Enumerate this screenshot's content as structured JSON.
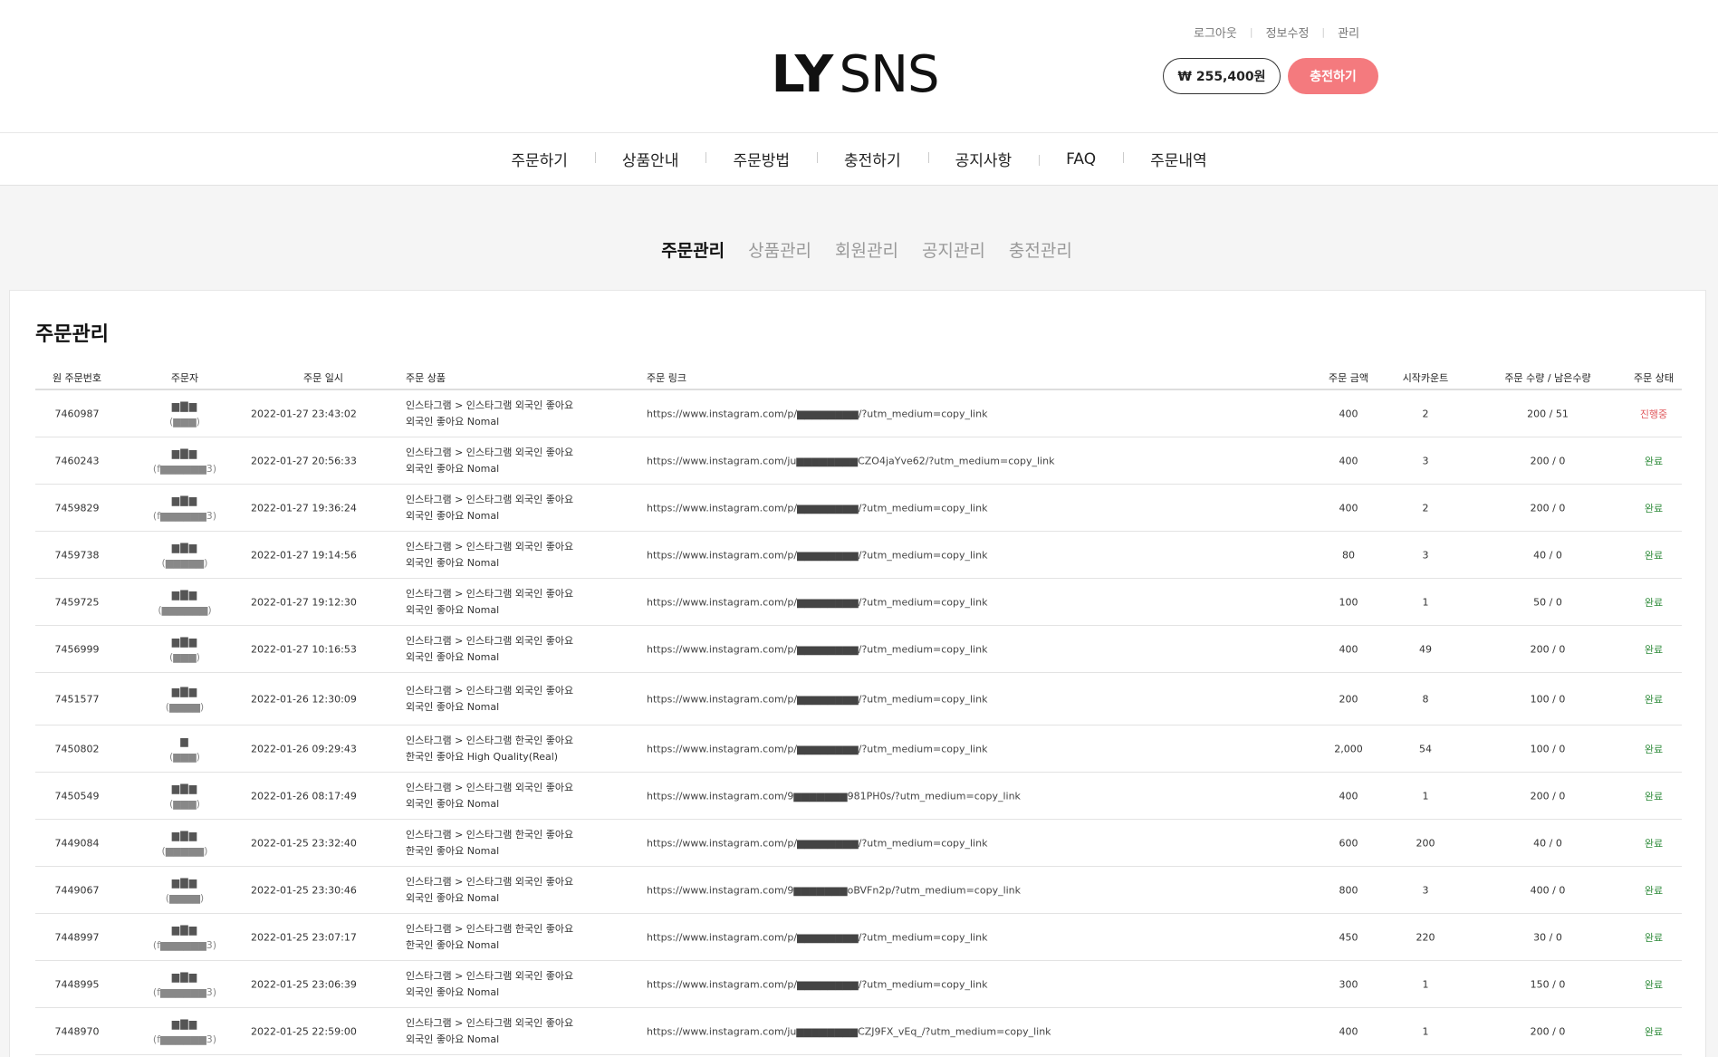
{
  "util_links": [
    "로그아웃",
    "정보수정",
    "관리"
  ],
  "logo": {
    "ly": "LY",
    "sns": "SNS"
  },
  "balance": "₩ 255,400원",
  "charge_button": "충전하기",
  "gnb": [
    "주문하기",
    "상품안내",
    "주문방법",
    "충전하기",
    "공지사항",
    "FAQ",
    "주문내역"
  ],
  "admin_tabs": [
    {
      "label": "주문관리",
      "active": true
    },
    {
      "label": "상품관리",
      "active": false
    },
    {
      "label": "회원관리",
      "active": false
    },
    {
      "label": "공지관리",
      "active": false
    },
    {
      "label": "충전관리",
      "active": false
    }
  ],
  "panel_title": "주문관리",
  "columns": {
    "order_no": "원 주문번호",
    "user": "주문자",
    "date": "주문 일시",
    "product": "주문 상품",
    "link": "주문 링크",
    "amount": "주문 금액",
    "start": "시작카운트",
    "qty": "주문 수량 / 남은수량",
    "status": "주문 상태"
  },
  "rows": [
    {
      "order_no": "7460987",
      "user_name": "▆▇▆",
      "user_id": "(▆▆▆)",
      "date": "2022-01-27 23:43:02",
      "product_line1": "인스타그램 > 인스타그램 외국인 좋아요",
      "product_line2": "외국인 좋아요 Nomal",
      "link": "https://www.instagram.com/p/▆▆▆▆▆▆▆▆/?utm_medium=copy_link",
      "amount": "400",
      "start": "2",
      "qty": "200 / 51",
      "status": "진행중",
      "progress": true
    },
    {
      "order_no": "7460243",
      "user_name": "▆▇▆",
      "user_id": "(f▆▆▆▆▆▆3)",
      "date": "2022-01-27 20:56:33",
      "product_line1": "인스타그램 > 인스타그램 외국인 좋아요",
      "product_line2": "외국인 좋아요 Nomal",
      "link": "https://www.instagram.com/ju▆▆▆▆▆▆▆▆CZO4jaYve62/?utm_medium=copy_link",
      "amount": "400",
      "start": "3",
      "qty": "200 / 0",
      "status": "완료",
      "progress": false
    },
    {
      "order_no": "7459829",
      "user_name": "▆▇▆",
      "user_id": "(f▆▆▆▆▆▆3)",
      "date": "2022-01-27 19:36:24",
      "product_line1": "인스타그램 > 인스타그램 외국인 좋아요",
      "product_line2": "외국인 좋아요 Nomal",
      "link": "https://www.instagram.com/p/▆▆▆▆▆▆▆▆/?utm_medium=copy_link",
      "amount": "400",
      "start": "2",
      "qty": "200 / 0",
      "status": "완료",
      "progress": false
    },
    {
      "order_no": "7459738",
      "user_name": "▆▇▆",
      "user_id": "(▆▆▆▆▆)",
      "date": "2022-01-27 19:14:56",
      "product_line1": "인스타그램 > 인스타그램 외국인 좋아요",
      "product_line2": "외국인 좋아요 Nomal",
      "link": "https://www.instagram.com/p/▆▆▆▆▆▆▆▆/?utm_medium=copy_link",
      "amount": "80",
      "start": "3",
      "qty": "40 / 0",
      "status": "완료",
      "progress": false
    },
    {
      "order_no": "7459725",
      "user_name": "▆▇▆",
      "user_id": "(▆▆▆▆▆▆)",
      "date": "2022-01-27 19:12:30",
      "product_line1": "인스타그램 > 인스타그램 외국인 좋아요",
      "product_line2": "외국인 좋아요 Nomal",
      "link": "https://www.instagram.com/p/▆▆▆▆▆▆▆▆/?utm_medium=copy_link",
      "amount": "100",
      "start": "1",
      "qty": "50 / 0",
      "status": "완료",
      "progress": false
    },
    {
      "order_no": "7456999",
      "user_name": "▆▇▆",
      "user_id": "(▆▆▆)",
      "date": "2022-01-27 10:16:53",
      "product_line1": "인스타그램 > 인스타그램 외국인 좋아요",
      "product_line2": "외국인 좋아요 Nomal",
      "link": "https://www.instagram.com/p/▆▆▆▆▆▆▆▆/?utm_medium=copy_link",
      "amount": "400",
      "start": "49",
      "qty": "200 / 0",
      "status": "완료",
      "progress": false
    },
    {
      "order_no": "7451577",
      "user_name": "▆▇▆",
      "user_id": "(▆▆▆▆)",
      "date": "2022-01-26 12:30:09",
      "product_line1": "인스타그램 > 인스타그램 외국인 좋아요",
      "product_line2": "외국인 좋아요 Nomal",
      "link": "https://www.instagram.com/p/▆▆▆▆▆▆▆▆/?utm_medium=copy_link",
      "amount": "200",
      "start": "8",
      "qty": "100 / 0",
      "status": "완료",
      "progress": false,
      "tall": true
    },
    {
      "order_no": "7450802",
      "user_name": "▆",
      "user_id": "(▆▆▆)",
      "date": "2022-01-26 09:29:43",
      "product_line1": "인스타그램 > 인스타그램 한국인 좋아요",
      "product_line2": "한국인 좋아요 High Quality(Real)",
      "link": "https://www.instagram.com/p/▆▆▆▆▆▆▆▆/?utm_medium=copy_link",
      "amount": "2,000",
      "start": "54",
      "qty": "100 / 0",
      "status": "완료",
      "progress": false
    },
    {
      "order_no": "7450549",
      "user_name": "▆▇▆",
      "user_id": "(▆▆▆)",
      "date": "2022-01-26 08:17:49",
      "product_line1": "인스타그램 > 인스타그램 외국인 좋아요",
      "product_line2": "외국인 좋아요 Nomal",
      "link": "https://www.instagram.com/9▆▆▆▆▆▆▆981PH0s/?utm_medium=copy_link",
      "amount": "400",
      "start": "1",
      "qty": "200 / 0",
      "status": "완료",
      "progress": false
    },
    {
      "order_no": "7449084",
      "user_name": "▆▇▆",
      "user_id": "(▆▆▆▆▆)",
      "date": "2022-01-25 23:32:40",
      "product_line1": "인스타그램 > 인스타그램 한국인 좋아요",
      "product_line2": "한국인 좋아요 Nomal",
      "link": "https://www.instagram.com/p/▆▆▆▆▆▆▆▆/?utm_medium=copy_link",
      "amount": "600",
      "start": "200",
      "qty": "40 / 0",
      "status": "완료",
      "progress": false
    },
    {
      "order_no": "7449067",
      "user_name": "▆▇▆",
      "user_id": "(▆▆▆▆)",
      "date": "2022-01-25 23:30:46",
      "product_line1": "인스타그램 > 인스타그램 외국인 좋아요",
      "product_line2": "외국인 좋아요 Nomal",
      "link": "https://www.instagram.com/9▆▆▆▆▆▆▆oBVFn2p/?utm_medium=copy_link",
      "amount": "800",
      "start": "3",
      "qty": "400 / 0",
      "status": "완료",
      "progress": false
    },
    {
      "order_no": "7448997",
      "user_name": "▆▇▆",
      "user_id": "(f▆▆▆▆▆▆3)",
      "date": "2022-01-25 23:07:17",
      "product_line1": "인스타그램 > 인스타그램 한국인 좋아요",
      "product_line2": "한국인 좋아요 Nomal",
      "link": "https://www.instagram.com/p/▆▆▆▆▆▆▆▆/?utm_medium=copy_link",
      "amount": "450",
      "start": "220",
      "qty": "30 / 0",
      "status": "완료",
      "progress": false
    },
    {
      "order_no": "7448995",
      "user_name": "▆▇▆",
      "user_id": "(f▆▆▆▆▆▆3)",
      "date": "2022-01-25 23:06:39",
      "product_line1": "인스타그램 > 인스타그램 외국인 좋아요",
      "product_line2": "외국인 좋아요 Nomal",
      "link": "https://www.instagram.com/p/▆▆▆▆▆▆▆▆/?utm_medium=copy_link",
      "amount": "300",
      "start": "1",
      "qty": "150 / 0",
      "status": "완료",
      "progress": false
    },
    {
      "order_no": "7448970",
      "user_name": "▆▇▆",
      "user_id": "(f▆▆▆▆▆▆3)",
      "date": "2022-01-25 22:59:00",
      "product_line1": "인스타그램 > 인스타그램 외국인 좋아요",
      "product_line2": "외국인 좋아요 Nomal",
      "link": "https://www.instagram.com/ju▆▆▆▆▆▆▆▆CZJ9FX_vEq_/?utm_medium=copy_link",
      "amount": "400",
      "start": "1",
      "qty": "200 / 0",
      "status": "완료",
      "progress": false
    }
  ],
  "colors": {
    "charge_button": "#f47a7e",
    "status_done": "#2e8b3a",
    "status_progress": "#e0585c"
  }
}
